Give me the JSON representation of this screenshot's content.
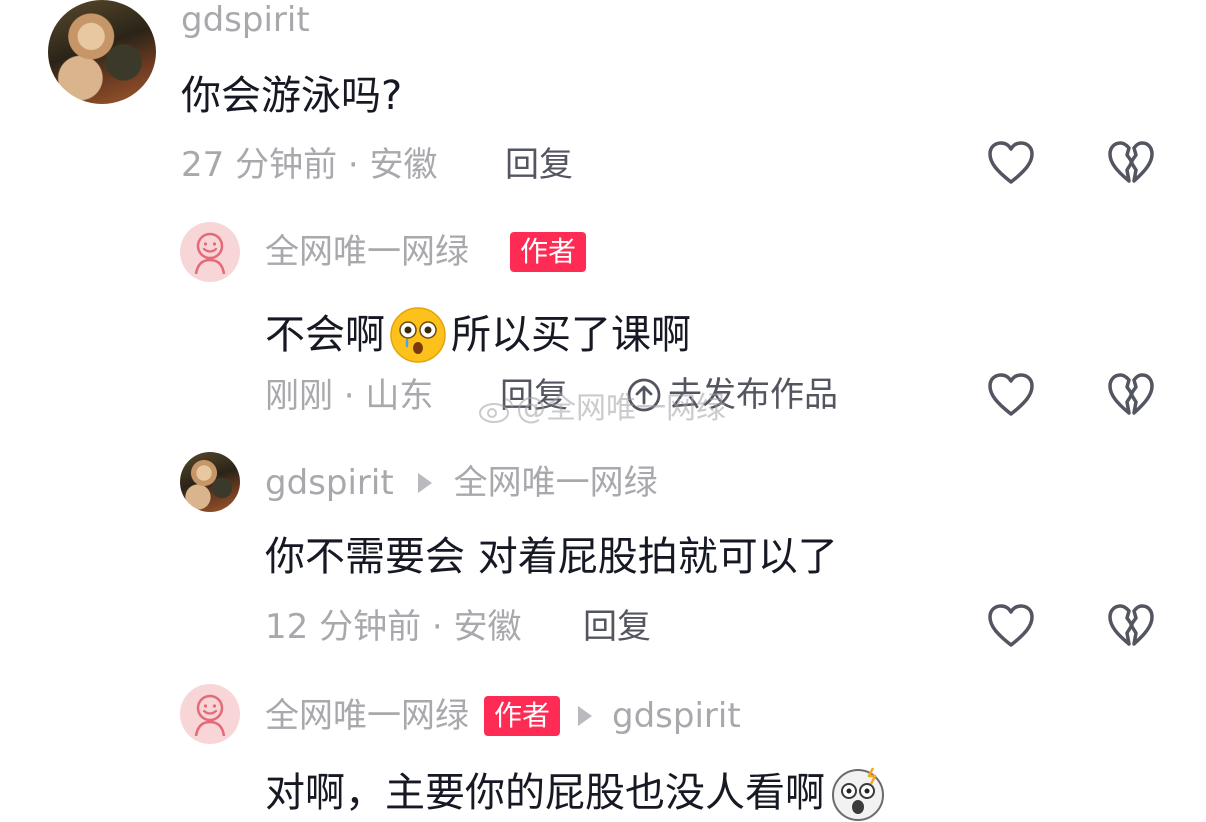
{
  "comments": [
    {
      "username": "gdspirit",
      "text": "你会游泳吗?",
      "meta": "27 分钟前 · 安徽",
      "reply_label": "回复"
    },
    {
      "username": "全网唯一网绿",
      "badge": "作者",
      "text_before": "不会啊",
      "text_after": "所以买了课啊",
      "meta": "刚刚 · 山东",
      "reply_label": "回复",
      "publish_label": "去发布作品"
    },
    {
      "username": "gdspirit",
      "reply_to": "全网唯一网绿",
      "text": "你不需要会 对着屁股拍就可以了",
      "meta": "12 分钟前 · 安徽",
      "reply_label": "回复"
    },
    {
      "username": "全网唯一网绿",
      "badge": "作者",
      "reply_to": "gdspirit",
      "text": "对啊，主要你的屁股也没人看啊"
    }
  ],
  "watermark": "@全网唯一网绿",
  "colors": {
    "badge": "#fe2c55",
    "text": "#161823",
    "muted": "#a8a9ad"
  },
  "icons": [
    "heart-icon",
    "broken-heart-icon",
    "publish-arrow-icon",
    "flushed-emoji",
    "shocked-emoji"
  ]
}
